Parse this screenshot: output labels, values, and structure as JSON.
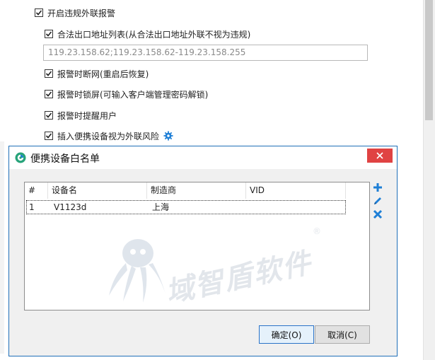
{
  "settings": {
    "enable_alarm": "开启违规外联报警",
    "legal_exit_list": "合法出口地址列表(从合法出口地址外联不视为违规)",
    "ip_value": "119.23.158.62;119.23.158.62-119.23.158.255",
    "disconnect_on_alarm": "报警时断网(重启后恢复)",
    "lock_on_alarm": "报警时锁屏(可输入客户端管理密码解锁)",
    "notify_on_alarm": "报警时提醒用户",
    "usb_as_risk": "插入便携设备视为外联风险"
  },
  "dialog": {
    "title": "便携设备白名单",
    "columns": [
      "#",
      "设备名",
      "制造商",
      "VID"
    ],
    "rows": [
      {
        "index": "1",
        "device": "V1123d",
        "vendor": "上海",
        "vid": ""
      }
    ],
    "ok_label": "确定(O)",
    "cancel_label": "取消(C)"
  },
  "watermark": {
    "text": "域智盾软件",
    "reg": "®"
  },
  "colors": {
    "accent": "#1f6fb8",
    "close_red": "#e04343",
    "icon_blue": "#1e7fd6"
  }
}
